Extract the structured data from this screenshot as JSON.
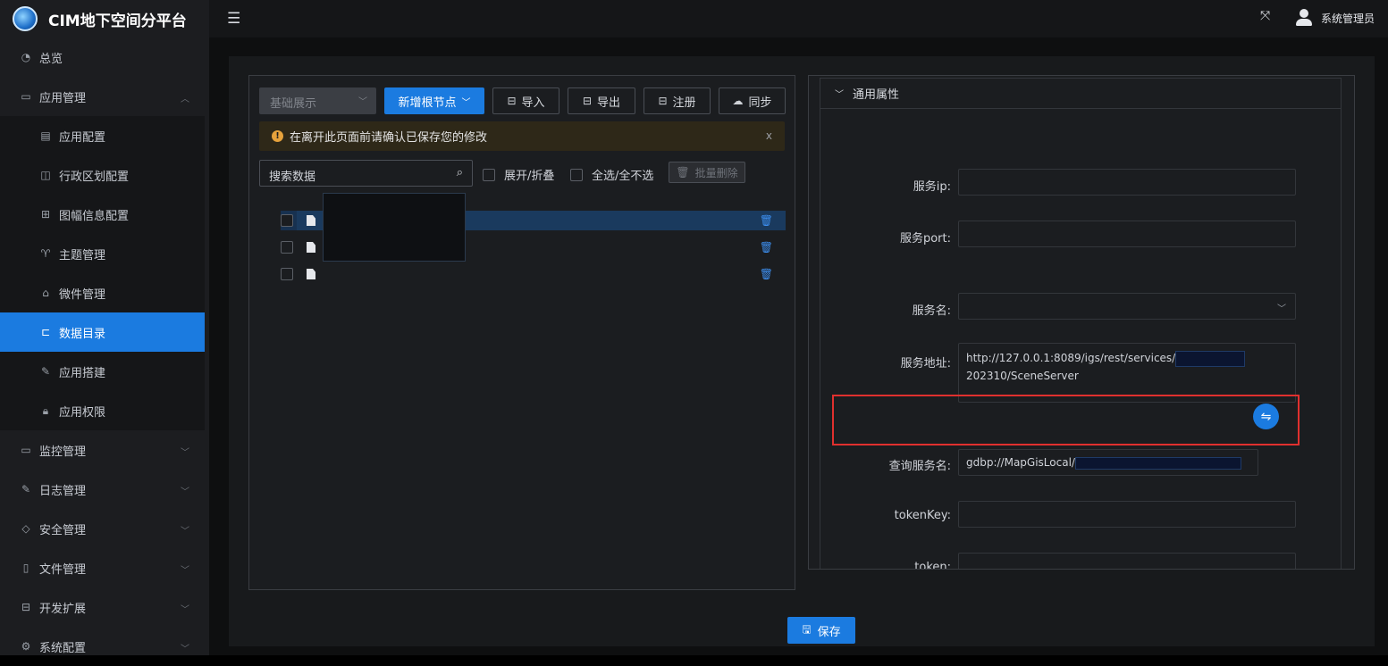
{
  "app": {
    "title": "CIM地下空间分平台",
    "user": "系统管理员"
  },
  "sidebar": {
    "items": [
      {
        "label": "总览",
        "icon": "dashboard-icon"
      },
      {
        "label": "应用管理",
        "icon": "monitor-icon",
        "expanded": true
      },
      {
        "label": "应用配置",
        "icon": "config-icon"
      },
      {
        "label": "行政区划配置",
        "icon": "columns-icon"
      },
      {
        "label": "图幅信息配置",
        "icon": "grid-icon"
      },
      {
        "label": "主题管理",
        "icon": "shirt-icon"
      },
      {
        "label": "微件管理",
        "icon": "puzzle-icon"
      },
      {
        "label": "数据目录",
        "icon": "tree-icon",
        "active": true
      },
      {
        "label": "应用搭建",
        "icon": "edit-icon"
      },
      {
        "label": "应用权限",
        "icon": "lock-icon"
      },
      {
        "label": "监控管理",
        "icon": "monitor-chart-icon"
      },
      {
        "label": "日志管理",
        "icon": "log-icon"
      },
      {
        "label": "安全管理",
        "icon": "shield-icon"
      },
      {
        "label": "文件管理",
        "icon": "file-icon"
      },
      {
        "label": "开发扩展",
        "icon": "toolbox-icon"
      },
      {
        "label": "系统配置",
        "icon": "gear-icon"
      }
    ]
  },
  "toolbar": {
    "select_value": "基础展示",
    "add_root": "新增根节点",
    "import": "导入",
    "export": "导出",
    "register": "注册",
    "sync": "同步"
  },
  "alert": {
    "message": "在离开此页面前请确认已保存您的修改",
    "close": "x"
  },
  "tree": {
    "search_placeholder": "搜索数据",
    "expand_collapse": "展开/折叠",
    "select_all": "全选/全不选",
    "batch_delete": "批量删除",
    "rows": [
      {
        "label": ""
      },
      {
        "label": ""
      },
      {
        "label": ""
      }
    ]
  },
  "properties": {
    "section_title": "通用属性",
    "fields": {
      "service_ip": {
        "label": "服务ip:",
        "value": ""
      },
      "service_port": {
        "label": "服务port:",
        "value": ""
      },
      "service_name": {
        "label": "服务名:",
        "value": ""
      },
      "service_url": {
        "label": "服务地址:",
        "value_line1": "http://127.0.0.1:8089/igs/rest/services/",
        "value_line2": "202310/SceneServer"
      },
      "query_service_name": {
        "label": "查询服务名:",
        "value": "gdbp://MapGisLocal/"
      },
      "token_key": {
        "label": "tokenKey:",
        "value": ""
      },
      "token": {
        "label": "token:",
        "value": ""
      }
    }
  },
  "footer": {
    "save": "保存"
  },
  "colors": {
    "accent": "#1b7be0",
    "highlight": "#e0302e",
    "warning": "#e6a23c"
  }
}
